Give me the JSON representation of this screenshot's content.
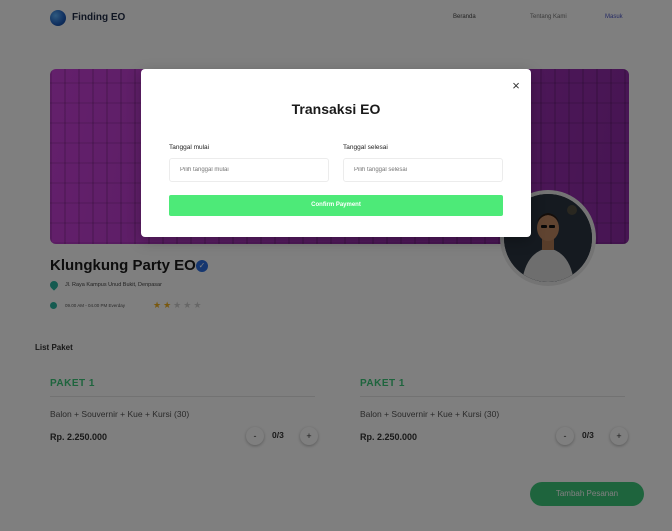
{
  "navbar": {
    "brand": "Finding EO",
    "links": [
      "Beranda",
      "Tentang Kami",
      "Masuk"
    ]
  },
  "profile": {
    "name": "Klungkung Party EO",
    "address": "Jl. Raya Kampus Unud Bukit, Denpasar",
    "hours": "09.00 AM - 04.00 PM Everday",
    "rating": 2,
    "rating_max": 5
  },
  "packages": {
    "section_title": "List Paket",
    "items": [
      {
        "name": "PAKET 1",
        "desc": "Balon + Souvernir + Kue + Kursi (30)",
        "price": "Rp. 2.250.000",
        "qty": "0/3",
        "minus": "-",
        "plus": "+"
      },
      {
        "name": "PAKET 1",
        "desc": "Balon + Souvernir + Kue + Kursi (30)",
        "price": "Rp. 2.250.000",
        "qty": "0/3",
        "minus": "-",
        "plus": "+"
      }
    ],
    "add_button": "Tambah Pesanan"
  },
  "modal": {
    "title": "Transaksi EO",
    "close_symbol": "×",
    "start_label": "Tanggal mulai",
    "start_placeholder": "Pilih tanggal mulai",
    "end_label": "Tanggal selesai",
    "end_placeholder": "Pilih tanggal selesai",
    "confirm_label": "Confirm Payment"
  },
  "colors": {
    "accent_green": "#3cc87a",
    "confirm_green": "#4dea78",
    "banner_purple": "#b53bc9",
    "verified_blue": "#2d6fe0"
  }
}
